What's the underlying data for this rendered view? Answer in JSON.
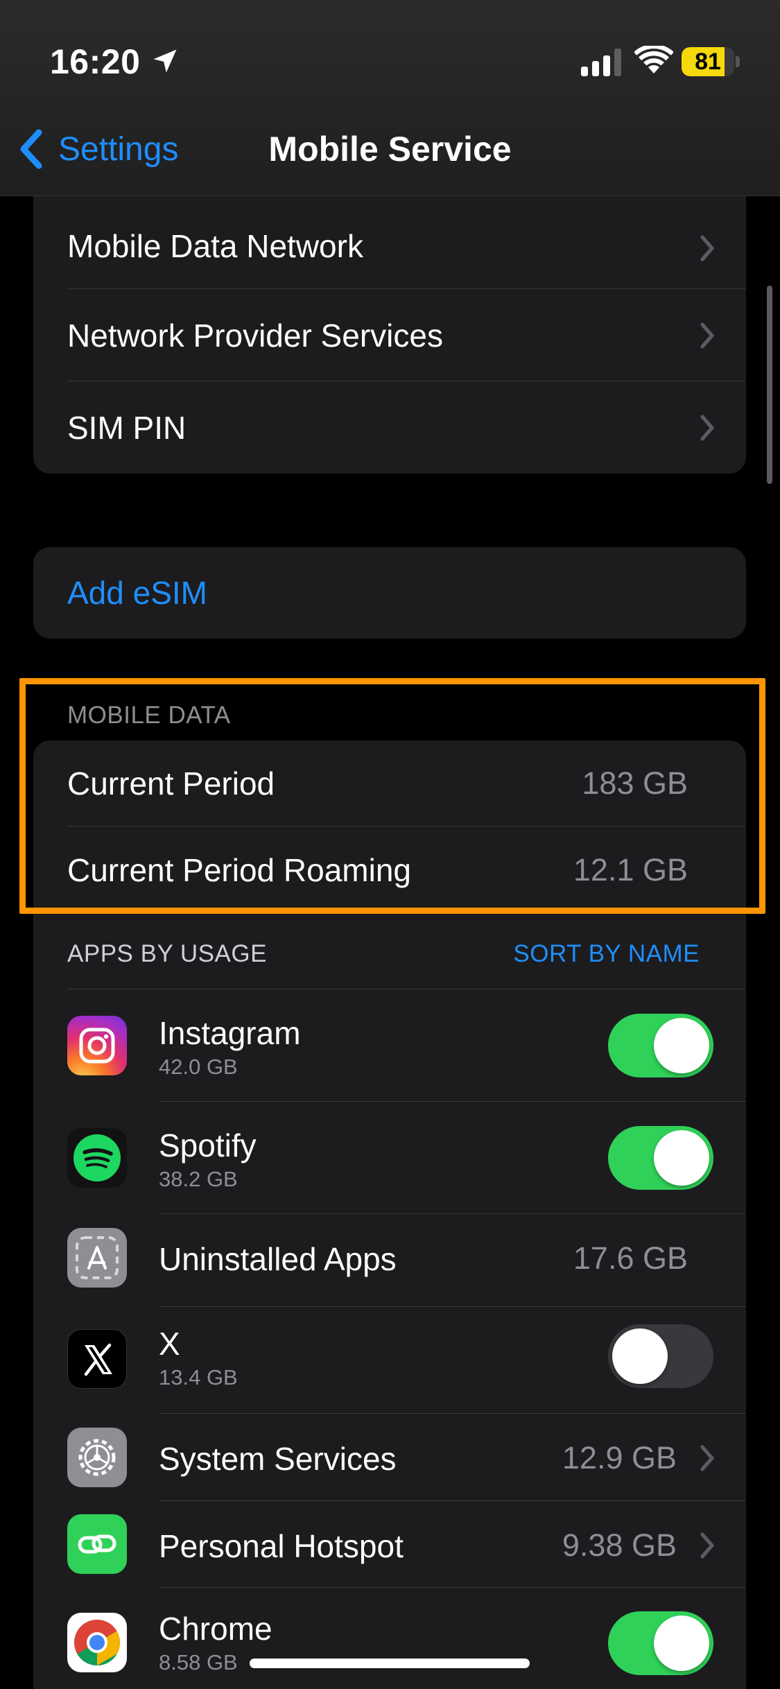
{
  "status": {
    "time": "16:20",
    "battery": "81",
    "battery_level": 0.81
  },
  "nav": {
    "back_label": "Settings",
    "title": "Mobile Service"
  },
  "network_group": {
    "items": [
      {
        "label": "Mobile Data Network"
      },
      {
        "label": "Network Provider Services"
      },
      {
        "label": "SIM PIN"
      }
    ]
  },
  "esim": {
    "label": "Add eSIM"
  },
  "mobile_data": {
    "header": "MOBILE DATA",
    "items": [
      {
        "label": "Current Period",
        "value": "183 GB"
      },
      {
        "label": "Current Period Roaming",
        "value": "12.1 GB"
      }
    ]
  },
  "apps": {
    "header": "APPS BY USAGE",
    "sort_label": "SORT BY NAME",
    "items": [
      {
        "name": "Instagram",
        "size": "42.0 GB",
        "control": "toggle",
        "on": true,
        "icon": "instagram-icon"
      },
      {
        "name": "Spotify",
        "size": "38.2 GB",
        "control": "toggle",
        "on": true,
        "icon": "spotify-icon"
      },
      {
        "name": "Uninstalled Apps",
        "value": "17.6 GB",
        "control": "value",
        "icon": "uninstalled-apps-icon"
      },
      {
        "name": "X",
        "size": "13.4 GB",
        "control": "toggle",
        "on": false,
        "icon": "x-icon"
      },
      {
        "name": "System Services",
        "value": "12.9 GB",
        "control": "chevron",
        "icon": "gear-icon"
      },
      {
        "name": "Personal Hotspot",
        "value": "9.38 GB",
        "control": "chevron",
        "icon": "hotspot-icon"
      },
      {
        "name": "Chrome",
        "size": "8.58 GB",
        "control": "toggle",
        "on": true,
        "icon": "chrome-icon"
      }
    ]
  },
  "colors": {
    "accent": "#1f8efa",
    "toggle_on": "#30d158",
    "highlight": "#ff9500",
    "battery": "#f5d90a"
  }
}
